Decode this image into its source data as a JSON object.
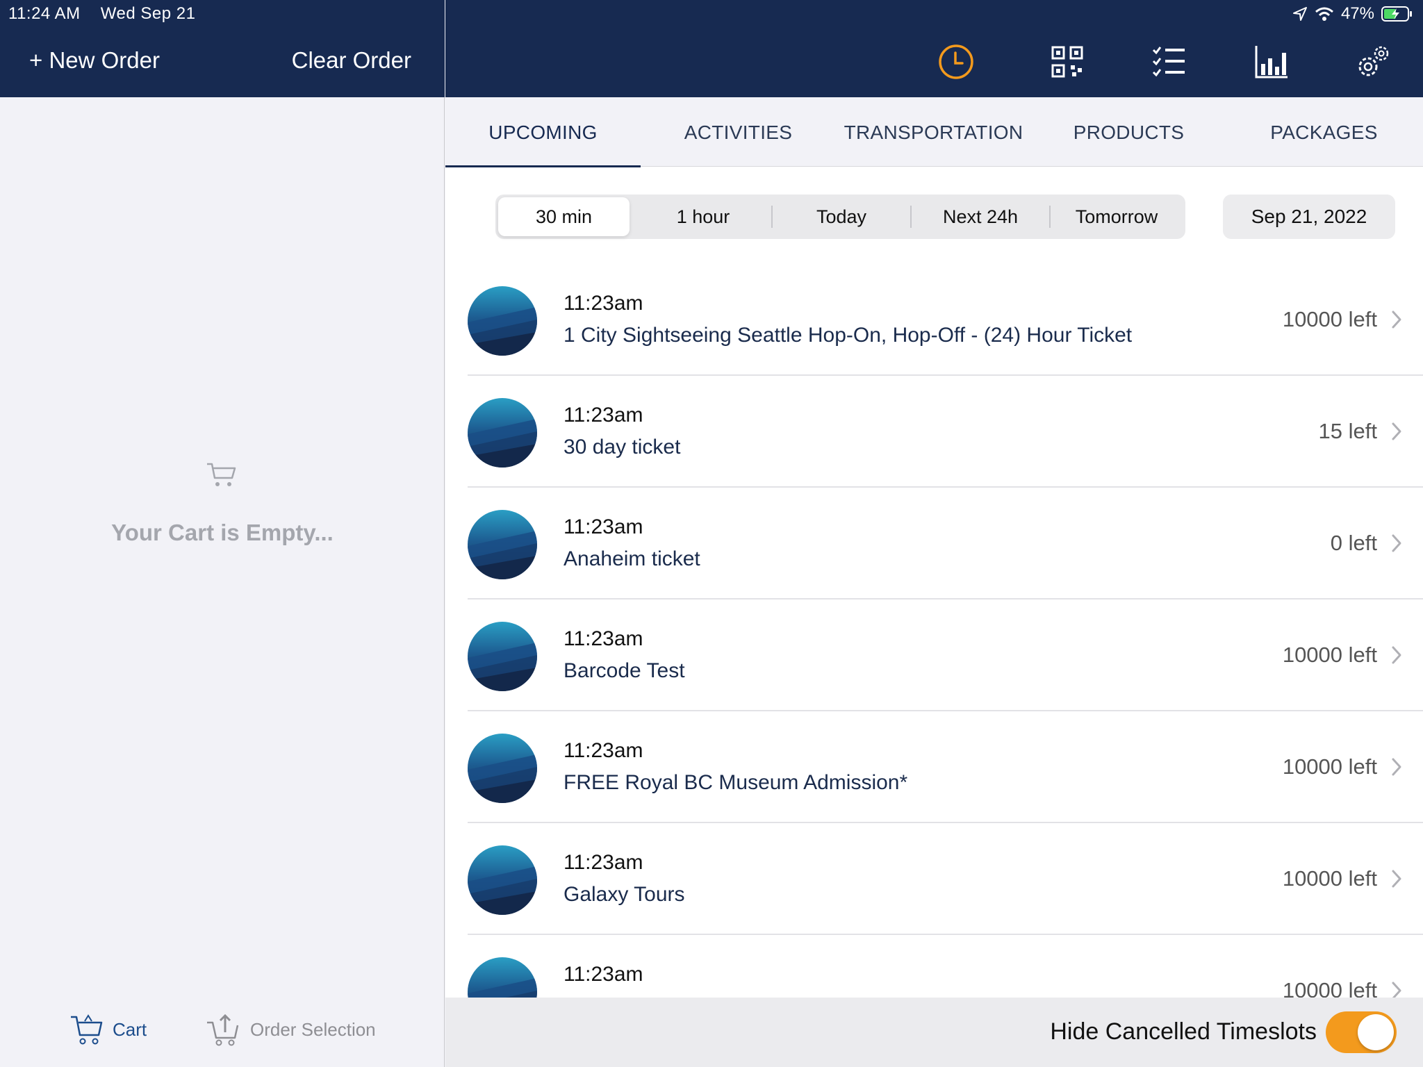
{
  "status_bar": {
    "time": "11:24 AM",
    "date": "Wed Sep 21",
    "battery": "47%"
  },
  "left_header": {
    "new_order": "+ New Order",
    "clear_order": "Clear Order"
  },
  "cart": {
    "empty_text": "Your Cart is Empty..."
  },
  "bottom_nav": {
    "cart": "Cart",
    "order_selection": "Order Selection"
  },
  "toolbar_icons": [
    "clock-icon",
    "qr-code-icon",
    "checklist-icon",
    "bar-chart-icon",
    "settings-icon"
  ],
  "tabs": [
    {
      "label": "UPCOMING",
      "active": true
    },
    {
      "label": "ACTIVITIES"
    },
    {
      "label": "TRANSPORTATION"
    },
    {
      "label": "PRODUCTS"
    },
    {
      "label": "PACKAGES"
    }
  ],
  "time_filter": {
    "options": [
      "30 min",
      "1 hour",
      "Today",
      "Next 24h",
      "Tomorrow"
    ],
    "selected": "30 min"
  },
  "date_picker": "Sep 21, 2022",
  "timeslots": [
    {
      "time": "11:23am",
      "name": "1 City Sightseeing Seattle Hop-On, Hop-Off - (24) Hour Ticket",
      "remaining": "10000 left"
    },
    {
      "time": "11:23am",
      "name": "30 day ticket",
      "remaining": "15 left"
    },
    {
      "time": "11:23am",
      "name": "Anaheim ticket",
      "remaining": "0 left"
    },
    {
      "time": "11:23am",
      "name": "Barcode Test",
      "remaining": "10000 left"
    },
    {
      "time": "11:23am",
      "name": "FREE Royal BC Museum Admission*",
      "remaining": "10000 left"
    },
    {
      "time": "11:23am",
      "name": "Galaxy Tours",
      "remaining": "10000 left"
    },
    {
      "time": "11:23am",
      "name": "",
      "remaining": "10000 left"
    }
  ],
  "footer": {
    "hide_cancelled_label": "Hide Cancelled Timeslots",
    "hide_cancelled_on": true
  },
  "colors": {
    "header_bg": "#172a51",
    "accent_orange": "#f39a1d",
    "cart_blue": "#1c4d8c"
  }
}
